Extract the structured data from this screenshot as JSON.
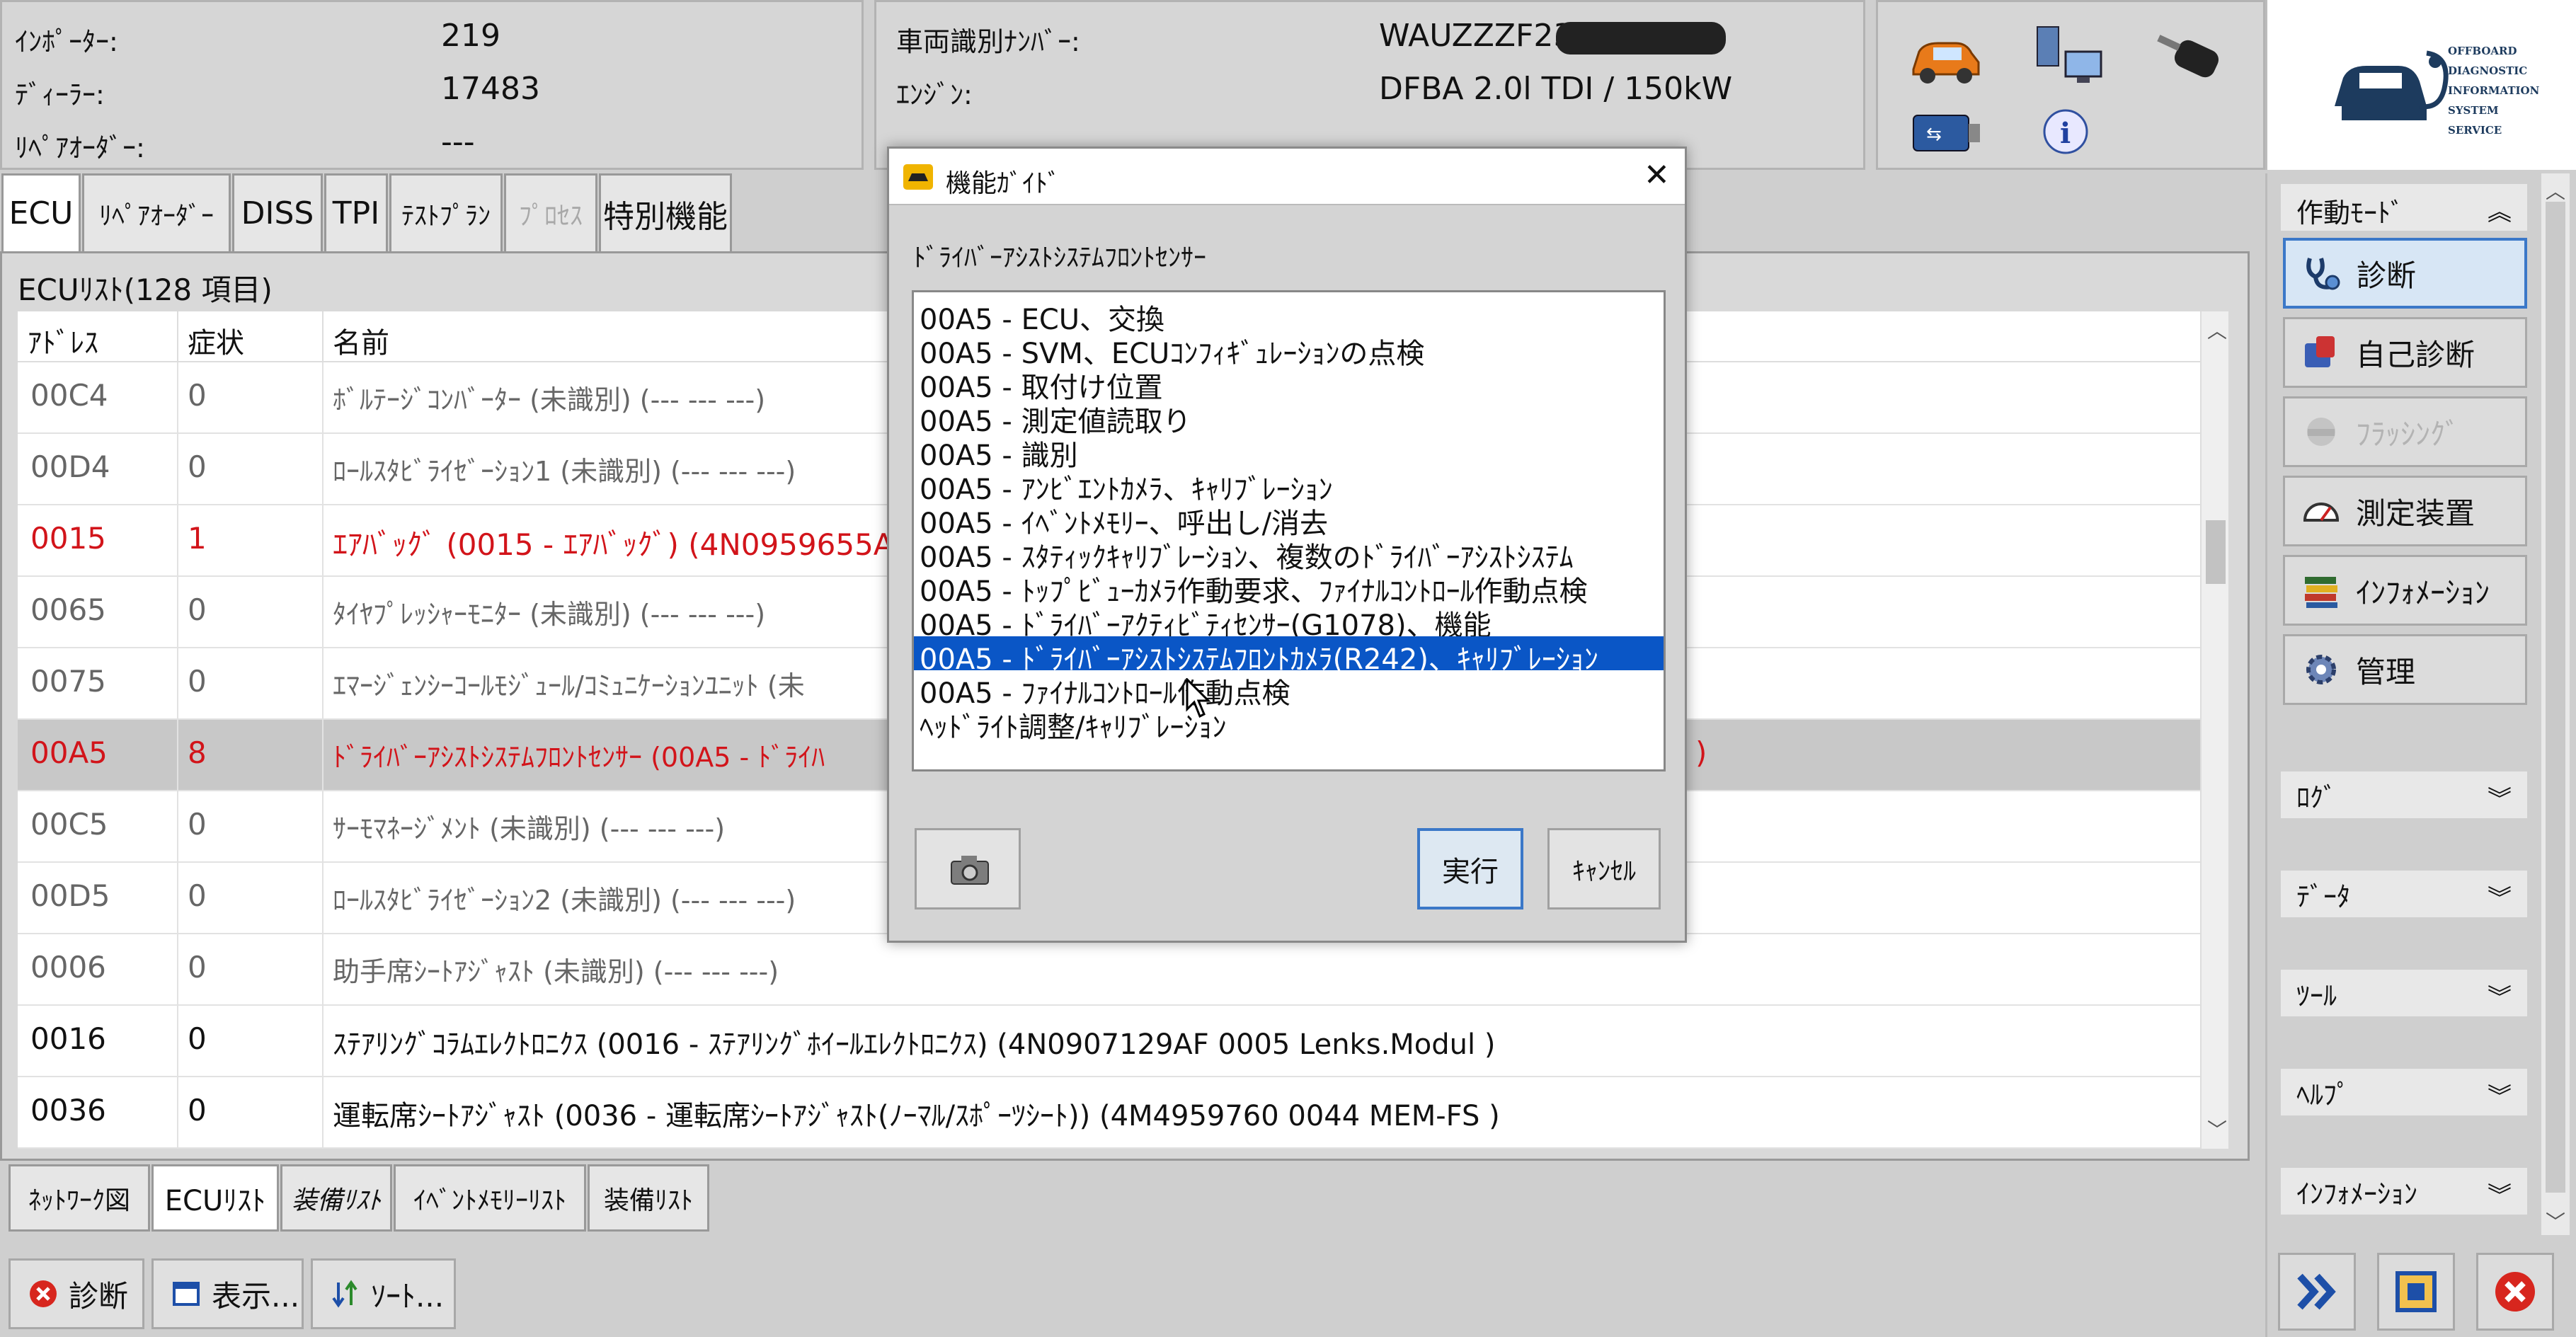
{
  "vehicle_info": {
    "importer_label": "ｲﾝﾎﾟｰﾀｰ:",
    "importer_value": "219",
    "dealer_label": "ﾃﾞｨｰﾗｰ:",
    "dealer_value": "17483",
    "repair_order_label": "ﾘﾍﾟｱｵｰﾀﾞｰ:",
    "repair_order_value": "---",
    "vin_label": "車両識別ﾅﾝﾊﾞｰ:",
    "vin_value": "WAUZZZF23L",
    "engine_label": "ｴﾝｼﾞﾝ:",
    "engine_value": "DFBA 2.0l TDI / 150kW"
  },
  "logo": {
    "lines": [
      "OFFBOARD",
      "DIAGNOSTIC",
      "INFORMATION",
      "SYSTEM",
      "SERVICE"
    ]
  },
  "tabs": [
    {
      "label": "ECU",
      "state": "active"
    },
    {
      "label": "ﾘﾍﾟｱｵｰﾀﾞｰ",
      "state": "normal"
    },
    {
      "label": "DISS",
      "state": "normal"
    },
    {
      "label": "TPI",
      "state": "normal"
    },
    {
      "label": "ﾃｽﾄﾌﾟﾗﾝ",
      "state": "normal"
    },
    {
      "label": "ﾌﾟﾛｾｽ",
      "state": "disabled"
    },
    {
      "label": "特別機能",
      "state": "normal"
    }
  ],
  "ecu_list": {
    "title": "ECUﾘｽﾄ(128 項目)",
    "col_address": "ｱﾄﾞﾚｽ",
    "col_symptom": "症状",
    "col_name": "名前",
    "rows": [
      {
        "address": "00C4",
        "symptom": "0",
        "name": "ﾎﾞﾙﾃｰｼﾞｺﾝﾊﾞｰﾀｰ (未識別) (---   ---   ---)",
        "style": "gray"
      },
      {
        "address": "00D4",
        "symptom": "0",
        "name": "ﾛｰﾙｽﾀﾋﾞﾗｲｾﾞｰｼｮﾝ1 (未識別) (---   ---   ---)",
        "style": "gray"
      },
      {
        "address": "0015",
        "symptom": "1",
        "name": "ｴｱﾊﾞｯｸﾞ (0015 - ｴｱﾊﾞｯｸﾞ) (4N0959655AJ",
        "style": "red"
      },
      {
        "address": "0065",
        "symptom": "0",
        "name": "ﾀｲﾔﾌﾟﾚｯｼｬｰﾓﾆﾀｰ (未識別) (---   ---   ---)",
        "style": "gray"
      },
      {
        "address": "0075",
        "symptom": "0",
        "name": "ｴﾏｰｼﾞｪﾝｼｰｺｰﾙﾓｼﾞｭｰﾙ/ｺﾐｭﾆｹｰｼｮﾝﾕﾆｯﾄ (未",
        "style": "gray"
      },
      {
        "address": "00A5",
        "symptom": "8",
        "name": "ﾄﾞﾗｲﾊﾞｰｱｼｽﾄｼｽﾃﾑﾌﾛﾝﾄｾﾝｻｰ (00A5 - ﾄﾞﾗｲﾊ",
        "name_tail": ")",
        "style": "red-selected"
      },
      {
        "address": "00C5",
        "symptom": "0",
        "name": "ｻｰﾓﾏﾈｰｼﾞﾒﾝﾄ (未識別) (---   ---   ---)",
        "style": "gray"
      },
      {
        "address": "00D5",
        "symptom": "0",
        "name": "ﾛｰﾙｽﾀﾋﾞﾗｲｾﾞｰｼｮﾝ2 (未識別) (---   ---   ---)",
        "style": "gray"
      },
      {
        "address": "0006",
        "symptom": "0",
        "name": "助手席ｼｰﾄｱｼﾞｬｽﾄ (未識別) (---   ---   ---)",
        "style": "gray"
      },
      {
        "address": "0016",
        "symptom": "0",
        "name": "ｽﾃｱﾘﾝｸﾞｺﾗﾑｴﾚｸﾄﾛﾆｸｽ (0016 - ｽﾃｱﾘﾝｸﾞﾎｲｰﾙｴﾚｸﾄﾛﾆｸｽ) (4N0907129AF   0005   Lenks.Modul  )",
        "style": "black"
      },
      {
        "address": "0036",
        "symptom": "0",
        "name": "運転席ｼｰﾄｱｼﾞｬｽﾄ (0036 - 運転席ｼｰﾄｱｼﾞｬｽﾄ(ﾉｰﾏﾙ/ｽﾎﾟｰﾂｼｰﾄ)) (4M4959760     0044   MEM-FS      )",
        "style": "black"
      }
    ]
  },
  "bottom_tabs": [
    {
      "label": "ﾈｯﾄﾜｰｸ図",
      "state": "normal"
    },
    {
      "label": "ECUﾘｽﾄ",
      "state": "active"
    },
    {
      "label": "装備ﾘｽﾄ",
      "state": "italic"
    },
    {
      "label": "ｲﾍﾞﾝﾄﾒﾓﾘｰﾘｽﾄ",
      "state": "normal"
    },
    {
      "label": "装備ﾘｽﾄ",
      "state": "normal"
    }
  ],
  "toolbar": {
    "diagnose_label": "診断",
    "display_label": "表示...",
    "sort_label": "ｿｰﾄ..."
  },
  "side_panel": {
    "mode_header": "作動ﾓｰﾄﾞ",
    "modes": [
      {
        "label": "診断",
        "state": "active",
        "icon": "stethoscope-icon"
      },
      {
        "label": "自己診断",
        "state": "normal",
        "icon": "self-diagnosis-icon"
      },
      {
        "label": "ﾌﾗｯｼﾝｸﾞ",
        "state": "disabled",
        "icon": "flashing-icon"
      },
      {
        "label": "測定装置",
        "state": "normal",
        "icon": "gauge-icon"
      },
      {
        "label": "ｲﾝﾌｫﾒｰｼｮﾝ",
        "state": "normal",
        "icon": "books-icon"
      },
      {
        "label": "管理",
        "state": "normal",
        "icon": "admin-gear-icon"
      }
    ],
    "sections": [
      "ﾛｸﾞ",
      "ﾃﾞｰﾀ",
      "ﾂｰﾙ",
      "ﾍﾙﾌﾟ",
      "ｲﾝﾌｫﾒｰｼｮﾝ"
    ]
  },
  "dialog": {
    "title": "機能ｶﾞｲﾄﾞ",
    "subtitle": "ﾄﾞﾗｲﾊﾞｰｱｼｽﾄｼｽﾃﾑﾌﾛﾝﾄｾﾝｻｰ",
    "selected_index": 10,
    "items": [
      "00A5 - ECU、交換",
      "00A5 - SVM、ECUｺﾝﾌｨｷﾞｭﾚｰｼｮﾝの点検",
      "00A5 - 取付け位置",
      "00A5 - 測定値読取り",
      "00A5 - 識別",
      "00A5 - ｱﾝﾋﾞｴﾝﾄｶﾒﾗ、ｷｬﾘﾌﾞﾚｰｼｮﾝ",
      "00A5 - ｲﾍﾞﾝﾄﾒﾓﾘｰ、呼出し/消去",
      "00A5 - ｽﾀﾃｨｯｸｷｬﾘﾌﾞﾚｰｼｮﾝ、複数のﾄﾞﾗｲﾊﾞｰｱｼｽﾄｼｽﾃﾑ",
      "00A5 - ﾄｯﾌﾟﾋﾞｭｰｶﾒﾗ作動要求、ﾌｧｲﾅﾙｺﾝﾄﾛｰﾙ作動点検",
      "00A5 - ﾄﾞﾗｲﾊﾞｰｱｸﾃｨﾋﾞﾃｨｾﾝｻｰ(G1078)、機能",
      "00A5 - ﾄﾞﾗｲﾊﾞｰｱｼｽﾄｼｽﾃﾑﾌﾛﾝﾄｶﾒﾗ(R242)、ｷｬﾘﾌﾞﾚｰｼｮﾝ",
      "00A5 - ﾌｧｲﾅﾙｺﾝﾄﾛｰﾙ作動点検",
      "ﾍｯﾄﾞﾗｲﾄ調整/ｷｬﾘﾌﾞﾚｰｼｮﾝ"
    ],
    "execute_label": "実行",
    "cancel_label": "ｷｬﾝｾﾙ"
  },
  "colors": {
    "accent_blue": "#0a56c6",
    "fault_red": "#d2141a",
    "selected_row": "#c8c8c8"
  }
}
